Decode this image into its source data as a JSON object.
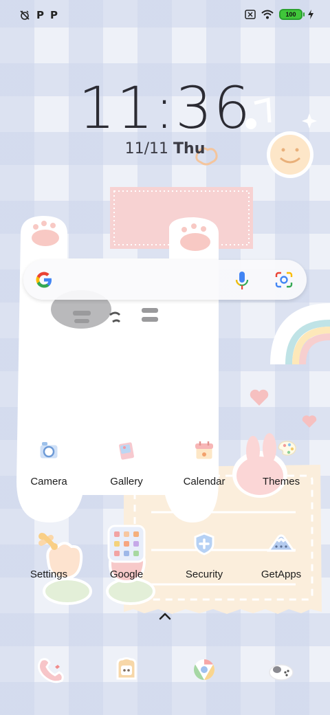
{
  "status_bar": {
    "left_icons": [
      "alarm-off-icon",
      "p-icon",
      "p-icon"
    ],
    "p_label": "P",
    "battery_level": "100",
    "right_icons": [
      "no-sim-icon",
      "wifi-icon",
      "battery-icon",
      "charging-icon"
    ]
  },
  "clock": {
    "time": "11:36",
    "date": "11/11",
    "day": "Thu"
  },
  "search_bar": {
    "left_icon": "google-g-icon",
    "mic_icon": "mic-icon",
    "lens_icon": "lens-icon"
  },
  "apps_row1": [
    {
      "label": "Camera",
      "icon": "camera-icon"
    },
    {
      "label": "Gallery",
      "icon": "gallery-icon"
    },
    {
      "label": "Calendar",
      "icon": "calendar-icon"
    },
    {
      "label": "Themes",
      "icon": "themes-icon"
    }
  ],
  "apps_row2": [
    {
      "label": "Settings",
      "icon": "settings-icon"
    },
    {
      "label": "Google",
      "icon": "google-folder-icon"
    },
    {
      "label": "Security",
      "icon": "security-icon"
    },
    {
      "label": "GetApps",
      "icon": "getapps-icon"
    }
  ],
  "dock": [
    "phone-icon",
    "messages-icon",
    "browser-icon",
    "camera-dock-icon"
  ],
  "colors": {
    "accent_pink": "#f6d3d3",
    "cat_white": "#ffffff",
    "paper": "#fbecd9"
  }
}
